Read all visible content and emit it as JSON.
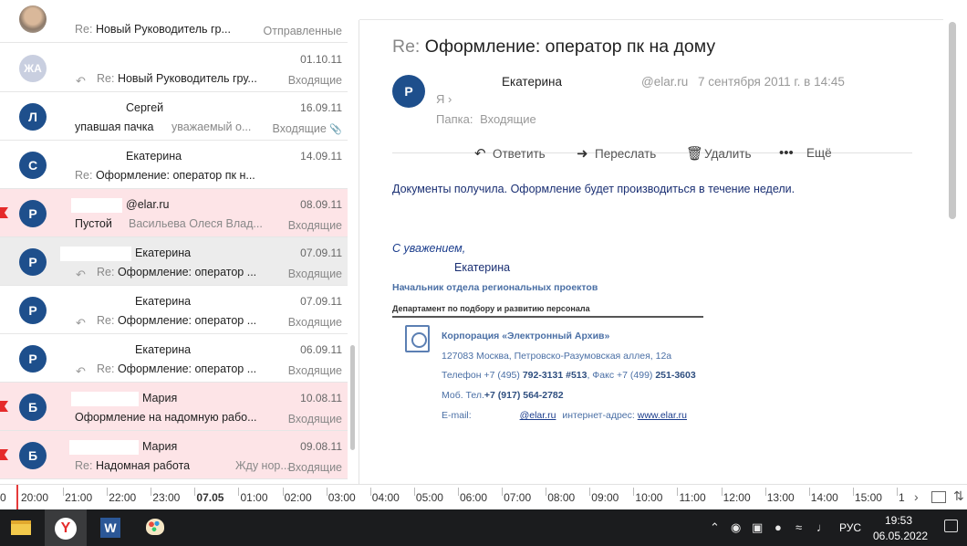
{
  "mail_list": [
    {
      "avatar": "",
      "photo": true,
      "from": "",
      "date": "",
      "subject_prefix": "Re:",
      "subject": "Новый Руководитель гр...",
      "snippet": "",
      "folder": "Отправленные",
      "replied": false,
      "attachment": false,
      "style": "normal",
      "flag": false
    },
    {
      "avatar": "ЖА",
      "from": "",
      "date": "01.10.11",
      "subject_prefix": "Re:",
      "subject": "Новый Руководитель гру...",
      "snippet": "",
      "folder": "Входящие",
      "replied": true,
      "attachment": false,
      "style": "normal",
      "flag": false
    },
    {
      "avatar": "Л",
      "from": "Сергей",
      "date": "16.09.11",
      "subject_prefix": "",
      "subject": "упавшая пачка",
      "snippet": "уважаемый о...",
      "folder": "Входящие",
      "replied": false,
      "attachment": true,
      "style": "normal",
      "flag": false
    },
    {
      "avatar": "С",
      "from": "Екатерина",
      "date": "14.09.11",
      "subject_prefix": "Re:",
      "subject": "Оформление: оператор пк н...",
      "snippet": "",
      "folder": "",
      "replied": false,
      "attachment": false,
      "style": "normal",
      "flag": false
    },
    {
      "avatar": "Р",
      "from": "@elar.ru",
      "date": "08.09.11",
      "subject_prefix": "",
      "subject": "Пустой",
      "snippet": "Васильева Олеся Влад...",
      "folder": "Входящие",
      "replied": false,
      "attachment": false,
      "style": "pink",
      "flag": true
    },
    {
      "avatar": "Р",
      "from": "Екатерина",
      "date": "07.09.11",
      "subject_prefix": "Re:",
      "subject": "Оформление: оператор ...",
      "snippet": "",
      "folder": "Входящие",
      "replied": true,
      "attachment": false,
      "style": "selected",
      "flag": false
    },
    {
      "avatar": "Р",
      "from": "Екатерина",
      "date": "07.09.11",
      "subject_prefix": "Re:",
      "subject": "Оформление: оператор ...",
      "snippet": "",
      "folder": "Входящие",
      "replied": true,
      "attachment": false,
      "style": "normal",
      "flag": false
    },
    {
      "avatar": "Р",
      "from": "Екатерина",
      "date": "06.09.11",
      "subject_prefix": "Re:",
      "subject": "Оформление: оператор ...",
      "snippet": "",
      "folder": "Входящие",
      "replied": true,
      "attachment": false,
      "style": "normal",
      "flag": false
    },
    {
      "avatar": "Б",
      "from": "Мария",
      "date": "10.08.11",
      "subject_prefix": "",
      "subject": "Оформление на надомную рабо...",
      "snippet": "",
      "folder": "Входящие",
      "replied": false,
      "attachment": false,
      "style": "pink",
      "flag": true
    },
    {
      "avatar": "Б",
      "from": "Мария",
      "date": "09.08.11",
      "subject_prefix": "Re:",
      "subject": "Надомная работа",
      "snippet": "Жду нор...",
      "folder": "Входящие",
      "replied": false,
      "attachment": false,
      "style": "pink",
      "flag": true
    }
  ],
  "message": {
    "title_prefix": "Re:",
    "title": "Оформление: оператор пк на дому",
    "avatar": "Р",
    "sender_name": "Екатерина",
    "sender_email": "@elar.ru",
    "sent_date": "7 сентября 2011 г. в 14:45",
    "to": "Я",
    "folder_label": "Папка:",
    "folder_value": "Входящие",
    "body": "Документы получила. Оформление будет производиться в течение недели.",
    "signature": {
      "greeting": "С уважением,",
      "name": "Екатерина",
      "role": "Начальник отдела региональных проектов",
      "department": "Департамент по подбору и развитию персонала",
      "company": "Корпорация «Электронный Архив»",
      "address": "127083 Москва, Петровско-Разумовская аллея, 12а",
      "phone_label": "Телефон +7 (495)",
      "phone": "792-3131 #513",
      "fax_label": ", Факс +7 (499)",
      "fax": "251-3603",
      "mobile_label": "Моб. Тел.",
      "mobile": "+7 (917) 564-2782",
      "email_label": "E-mail:",
      "email": "@elar.ru",
      "web_label": "интернет-адрес:",
      "web": "www.elar.ru"
    }
  },
  "toolbar": {
    "reply_label": "Ответить",
    "forward_label": "Переслать",
    "delete_label": "Удалить",
    "more_label": "Ещё"
  },
  "timeline": {
    "ticks": [
      "0",
      "20:00",
      "21:00",
      "22:00",
      "23:00",
      "07.05",
      "01:00",
      "02:00",
      "03:00",
      "04:00",
      "05:00",
      "06:00",
      "07:00",
      "08:00",
      "09:00",
      "10:00",
      "11:00",
      "12:00",
      "13:00",
      "14:00",
      "15:00",
      "1"
    ],
    "bold_tick": "07.05"
  },
  "taskbar": {
    "language": "РУС",
    "time": "19:53",
    "date": "06.05.2022"
  },
  "colors": {
    "avatar_blue": "#1e4f8c",
    "unread_pink": "#fde4e7",
    "flag_red": "#e52a2a",
    "signature_blue": "#4a6fa5"
  }
}
